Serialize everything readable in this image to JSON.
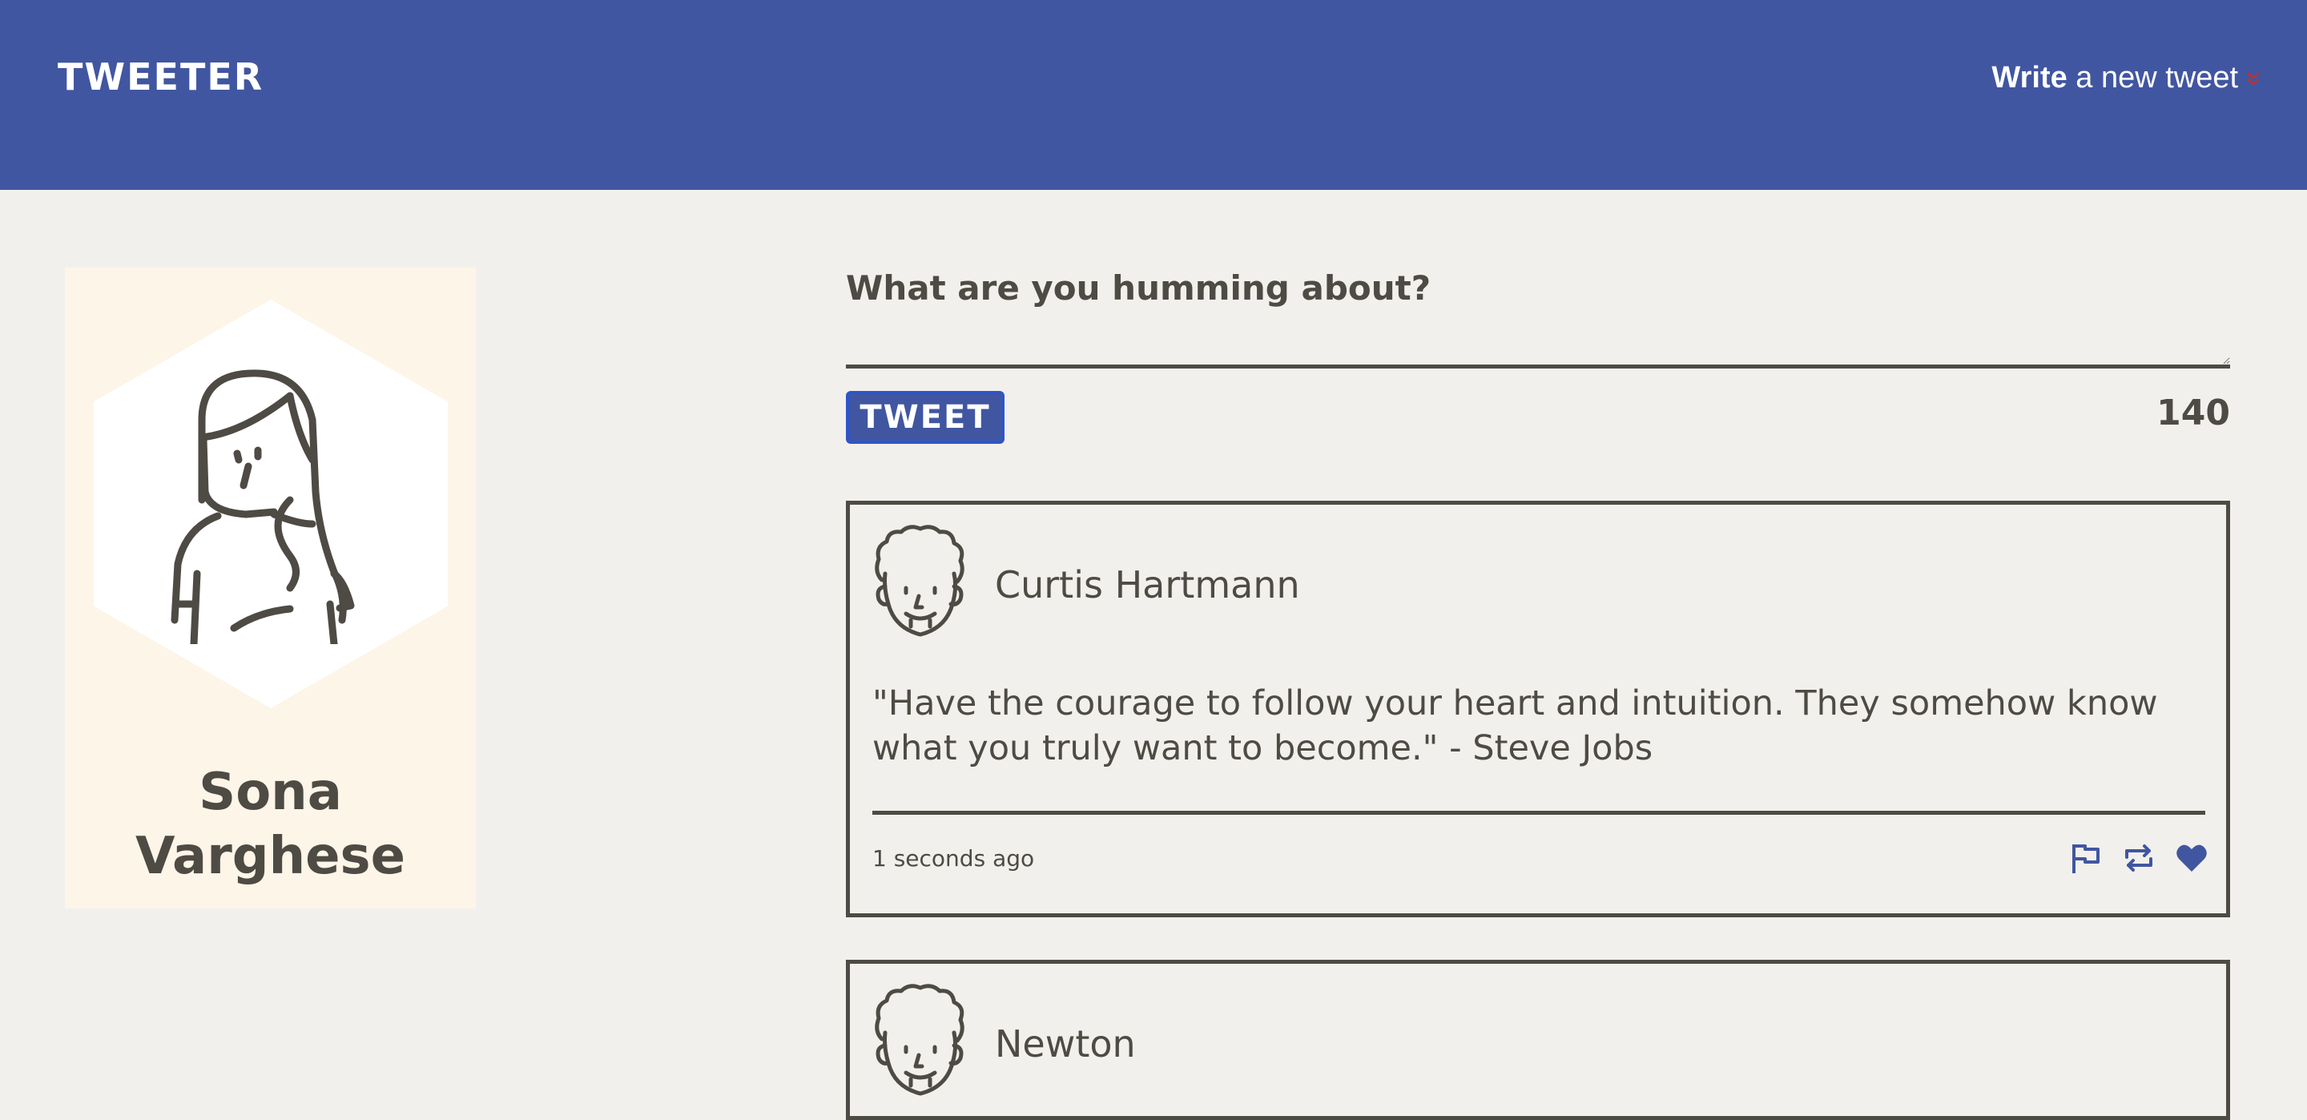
{
  "header": {
    "brand": "TWEETER",
    "compose_bold": "Write",
    "compose_rest": " a new tweet",
    "compose_chevron": "»",
    "chevron_icon": "double-chevron-down-icon",
    "accent": "#c0312f",
    "background": "#4156a1"
  },
  "profile": {
    "name": "Sona Varghese",
    "avatar_icon": "woman-avatar-icon"
  },
  "composer": {
    "label": "What are you humming about?",
    "text": "",
    "button_label": "TWEET",
    "counter": "140"
  },
  "tweets": [
    {
      "author": "Curtis Hartmann",
      "avatar_icon": "curly-hair-man-avatar-icon",
      "text": "\"Have the courage to follow your heart and intuition. They somehow know what you truly want to become.\" - Steve Jobs",
      "time": "1 seconds ago",
      "actions": [
        "flag-icon",
        "retweet-icon",
        "heart-icon"
      ]
    },
    {
      "author": "Newton",
      "avatar_icon": "curly-hair-man-avatar-icon"
    }
  ]
}
